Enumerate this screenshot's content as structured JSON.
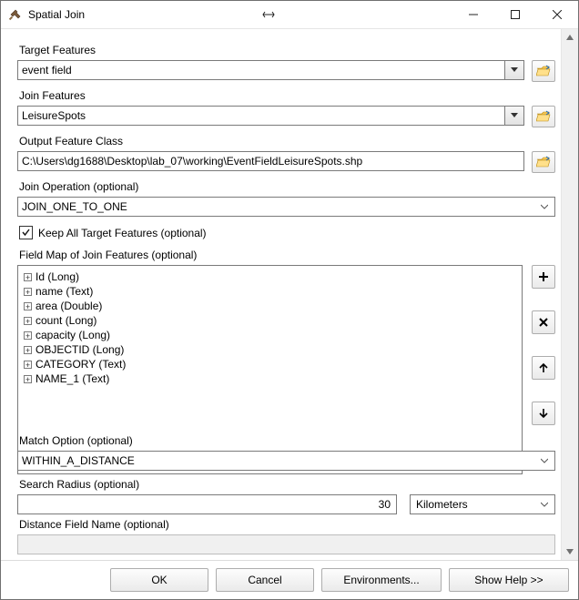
{
  "window": {
    "title": "Spatial Join"
  },
  "target_features": {
    "label": "Target Features",
    "value": "event field"
  },
  "join_features": {
    "label": "Join Features",
    "value": "LeisureSpots"
  },
  "output_feature_class": {
    "label": "Output Feature Class",
    "value": "C:\\Users\\dg1688\\Desktop\\lab_07\\working\\EventFieldLeisureSpots.shp"
  },
  "join_operation": {
    "label": "Join Operation (optional)",
    "value": "JOIN_ONE_TO_ONE"
  },
  "keep_all": {
    "label": "Keep All Target Features (optional)",
    "checked": true
  },
  "field_map": {
    "label": "Field Map of Join Features (optional)",
    "items": [
      "Id (Long)",
      "name (Text)",
      "area (Double)",
      "count (Long)",
      "capacity (Long)",
      "OBJECTID (Long)",
      "CATEGORY (Text)",
      "NAME_1 (Text)"
    ]
  },
  "match_option": {
    "label": "Match Option (optional)",
    "value": "WITHIN_A_DISTANCE"
  },
  "search_radius": {
    "label": "Search Radius (optional)",
    "value": "30",
    "unit": "Kilometers"
  },
  "distance_field": {
    "label": "Distance Field Name (optional)",
    "value": ""
  },
  "footer": {
    "ok": "OK",
    "cancel": "Cancel",
    "environments": "Environments...",
    "show_help": "Show Help >>"
  }
}
